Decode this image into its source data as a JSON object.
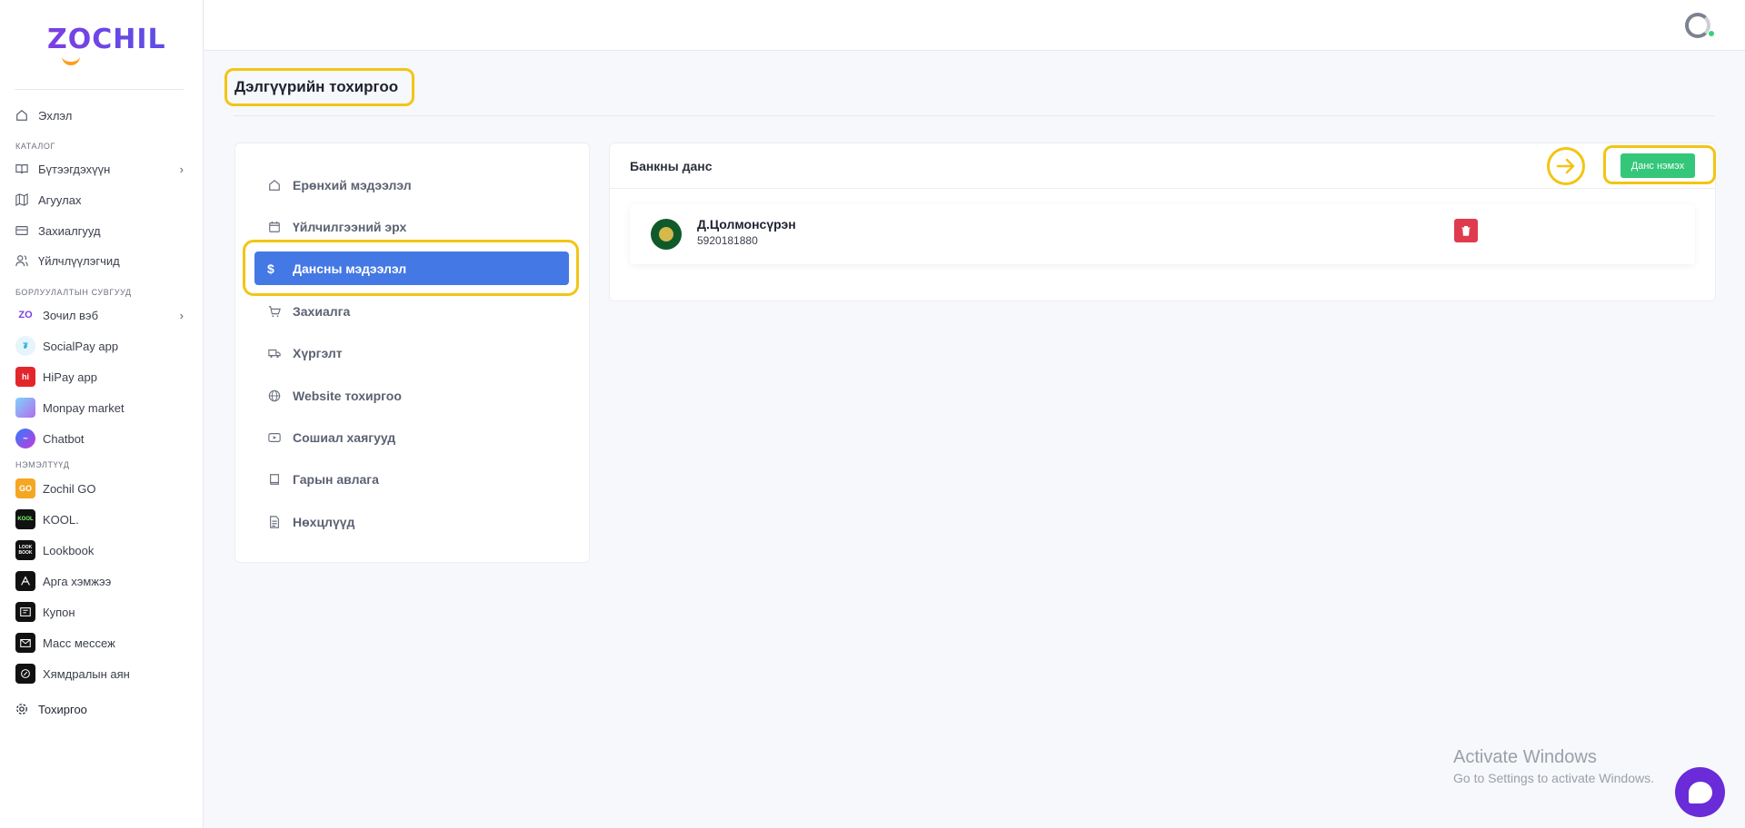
{
  "brand": {
    "logo_text": "ZOCHIL",
    "accent": "#4478e5",
    "highlight": "#f2c514"
  },
  "sidebar": {
    "home": "Эхлэл",
    "section_catalog": "КАТАЛОГ",
    "catalog": [
      "Бүтээгдэхүүн",
      "Агуулах",
      "Захиалгууд",
      "Үйлчлүүлэгчид"
    ],
    "section_channels": "БОРЛУУЛАЛТЫН СУВГУУД",
    "channels": [
      "Зочил вэб",
      "SocialPay app",
      "HiPay app",
      "Monpay market",
      "Chatbot"
    ],
    "section_addons": "НЭМЭЛТҮҮД",
    "addons": [
      "Zochil GO",
      "KOOL.",
      "Lookbook",
      "Арга хэмжээ",
      "Купон",
      "Масс мессеж",
      "Хямдралын аян"
    ],
    "settings": "Тохиргоо",
    "icons": {
      "zochil_go": "GO",
      "kool": "KOOL",
      "lookbook": "LOOK BOOK"
    }
  },
  "page": {
    "title": "Дэлгүүрийн тохиргоо"
  },
  "settings_menu": {
    "items": [
      "Ерөнхий мэдээлэл",
      "Үйлчилгээний эрх",
      "Дансны мэдээлэл",
      "Захиалга",
      "Хүргэлт",
      "Website тохиргоо",
      "Сошиал хаягууд",
      "Гарын авлага",
      "Нөхцлүүд"
    ],
    "active_index": 2
  },
  "bank": {
    "title": "Банкны данс",
    "add_button": "Данс нэмэх",
    "account_name": "Д.Цолмонсүрэн",
    "account_number": "5920181880"
  },
  "watermark": {
    "title": "Activate Windows",
    "subtitle": "Go to Settings to activate Windows."
  }
}
